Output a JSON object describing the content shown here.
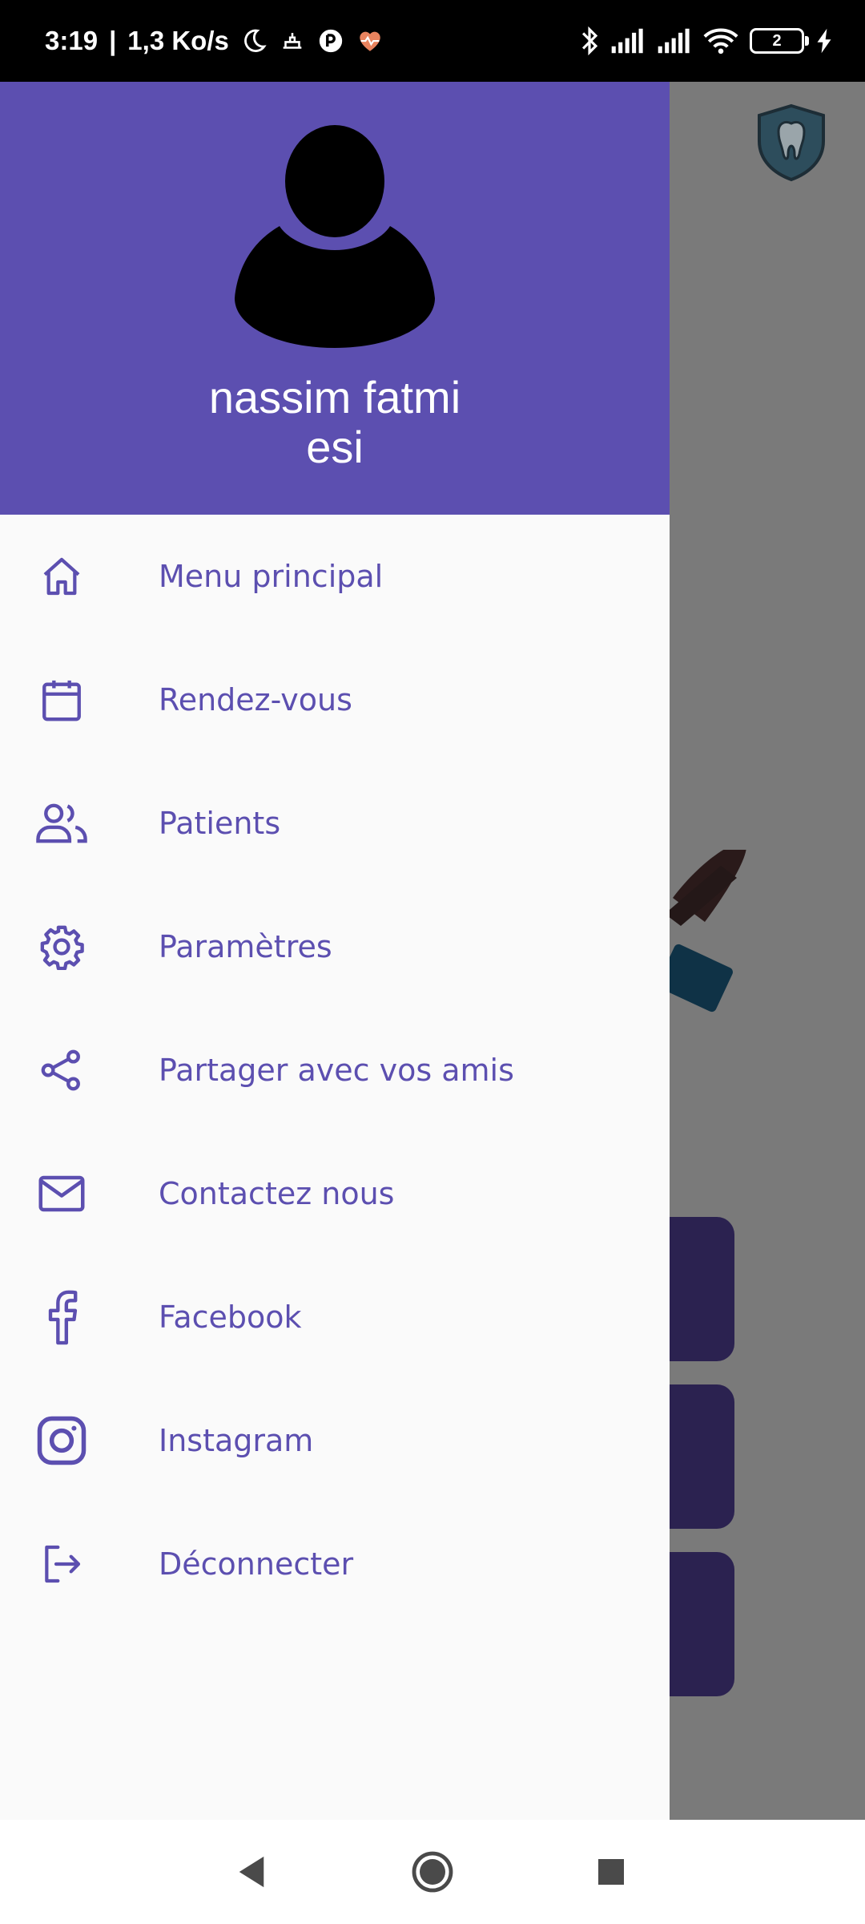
{
  "status_bar": {
    "time": "3:19",
    "separator": "|",
    "network_speed": "1,3 Ko/s",
    "battery_level": "2",
    "icons_left": [
      "moon-icon",
      "prayer-app-icon",
      "app-circle-icon",
      "heart-rate-icon"
    ],
    "icons_right": [
      "bluetooth-icon",
      "signal-icon",
      "signal-icon",
      "wifi-icon",
      "battery-icon",
      "charging-icon"
    ]
  },
  "drawer": {
    "header": {
      "user_name": "nassim fatmi",
      "organization": "esi",
      "background_color": "#5c4fb0"
    },
    "items": [
      {
        "label": "Menu principal",
        "icon": "home-icon"
      },
      {
        "label": "Rendez-vous",
        "icon": "calendar-icon"
      },
      {
        "label": "Patients",
        "icon": "users-icon"
      },
      {
        "label": "Paramètres",
        "icon": "gear-icon"
      },
      {
        "label": "Partager avec vos amis",
        "icon": "share-icon"
      },
      {
        "label": "Contactez nous",
        "icon": "mail-icon"
      },
      {
        "label": "Facebook",
        "icon": "facebook-icon"
      },
      {
        "label": "Instagram",
        "icon": "instagram-icon"
      },
      {
        "label": "Déconnecter",
        "icon": "logout-icon"
      }
    ],
    "accent_color": "#5c4fb0"
  },
  "background_app": {
    "logo_icon": "tooth-shield-icon",
    "card_color": "#2b2250"
  },
  "nav_bar": {
    "buttons": [
      "back-icon",
      "home-circle-icon",
      "recents-icon"
    ]
  }
}
